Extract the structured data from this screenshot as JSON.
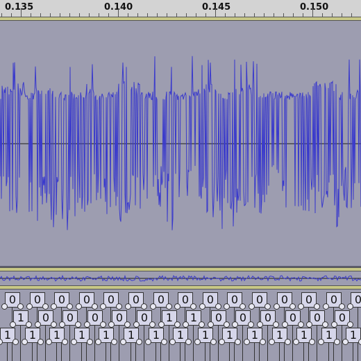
{
  "timeline": {
    "ticks": [
      "0.135",
      "0.140",
      "0.145",
      "0.150"
    ]
  },
  "tracks": {
    "waveform": {
      "name": "audio-waveform",
      "color": "#3a3acc",
      "background": "#9d9db0"
    },
    "bits": {
      "rows": [
        {
          "label_row": 1,
          "bits": [
            "0",
            "0",
            "0",
            "0",
            "0",
            "0",
            "0",
            "0",
            "0",
            "0",
            "0",
            "0",
            "0",
            "0",
            "0"
          ]
        },
        {
          "label_row": 2,
          "bits": [
            "1",
            "0",
            "0",
            "0",
            "0",
            "0",
            "1",
            "1",
            "0",
            "0",
            "0",
            "0",
            "0",
            "0"
          ]
        },
        {
          "label_row": 3,
          "bits": [
            "1",
            "1",
            "1",
            "1",
            "1",
            "1",
            "1",
            "1",
            "1",
            "1",
            "1",
            "1",
            "1",
            "1",
            "1"
          ]
        }
      ]
    }
  }
}
